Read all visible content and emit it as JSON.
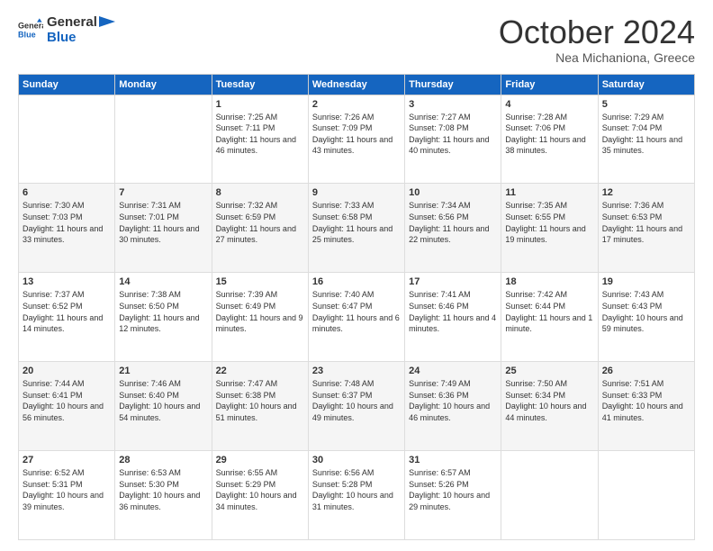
{
  "header": {
    "logo_general": "General",
    "logo_blue": "Blue",
    "month_title": "October 2024",
    "subtitle": "Nea Michaniona, Greece"
  },
  "weekdays": [
    "Sunday",
    "Monday",
    "Tuesday",
    "Wednesday",
    "Thursday",
    "Friday",
    "Saturday"
  ],
  "weeks": [
    [
      {
        "day": "",
        "info": ""
      },
      {
        "day": "",
        "info": ""
      },
      {
        "day": "1",
        "info": "Sunrise: 7:25 AM\nSunset: 7:11 PM\nDaylight: 11 hours and 46 minutes."
      },
      {
        "day": "2",
        "info": "Sunrise: 7:26 AM\nSunset: 7:09 PM\nDaylight: 11 hours and 43 minutes."
      },
      {
        "day": "3",
        "info": "Sunrise: 7:27 AM\nSunset: 7:08 PM\nDaylight: 11 hours and 40 minutes."
      },
      {
        "day": "4",
        "info": "Sunrise: 7:28 AM\nSunset: 7:06 PM\nDaylight: 11 hours and 38 minutes."
      },
      {
        "day": "5",
        "info": "Sunrise: 7:29 AM\nSunset: 7:04 PM\nDaylight: 11 hours and 35 minutes."
      }
    ],
    [
      {
        "day": "6",
        "info": "Sunrise: 7:30 AM\nSunset: 7:03 PM\nDaylight: 11 hours and 33 minutes."
      },
      {
        "day": "7",
        "info": "Sunrise: 7:31 AM\nSunset: 7:01 PM\nDaylight: 11 hours and 30 minutes."
      },
      {
        "day": "8",
        "info": "Sunrise: 7:32 AM\nSunset: 6:59 PM\nDaylight: 11 hours and 27 minutes."
      },
      {
        "day": "9",
        "info": "Sunrise: 7:33 AM\nSunset: 6:58 PM\nDaylight: 11 hours and 25 minutes."
      },
      {
        "day": "10",
        "info": "Sunrise: 7:34 AM\nSunset: 6:56 PM\nDaylight: 11 hours and 22 minutes."
      },
      {
        "day": "11",
        "info": "Sunrise: 7:35 AM\nSunset: 6:55 PM\nDaylight: 11 hours and 19 minutes."
      },
      {
        "day": "12",
        "info": "Sunrise: 7:36 AM\nSunset: 6:53 PM\nDaylight: 11 hours and 17 minutes."
      }
    ],
    [
      {
        "day": "13",
        "info": "Sunrise: 7:37 AM\nSunset: 6:52 PM\nDaylight: 11 hours and 14 minutes."
      },
      {
        "day": "14",
        "info": "Sunrise: 7:38 AM\nSunset: 6:50 PM\nDaylight: 11 hours and 12 minutes."
      },
      {
        "day": "15",
        "info": "Sunrise: 7:39 AM\nSunset: 6:49 PM\nDaylight: 11 hours and 9 minutes."
      },
      {
        "day": "16",
        "info": "Sunrise: 7:40 AM\nSunset: 6:47 PM\nDaylight: 11 hours and 6 minutes."
      },
      {
        "day": "17",
        "info": "Sunrise: 7:41 AM\nSunset: 6:46 PM\nDaylight: 11 hours and 4 minutes."
      },
      {
        "day": "18",
        "info": "Sunrise: 7:42 AM\nSunset: 6:44 PM\nDaylight: 11 hours and 1 minute."
      },
      {
        "day": "19",
        "info": "Sunrise: 7:43 AM\nSunset: 6:43 PM\nDaylight: 10 hours and 59 minutes."
      }
    ],
    [
      {
        "day": "20",
        "info": "Sunrise: 7:44 AM\nSunset: 6:41 PM\nDaylight: 10 hours and 56 minutes."
      },
      {
        "day": "21",
        "info": "Sunrise: 7:46 AM\nSunset: 6:40 PM\nDaylight: 10 hours and 54 minutes."
      },
      {
        "day": "22",
        "info": "Sunrise: 7:47 AM\nSunset: 6:38 PM\nDaylight: 10 hours and 51 minutes."
      },
      {
        "day": "23",
        "info": "Sunrise: 7:48 AM\nSunset: 6:37 PM\nDaylight: 10 hours and 49 minutes."
      },
      {
        "day": "24",
        "info": "Sunrise: 7:49 AM\nSunset: 6:36 PM\nDaylight: 10 hours and 46 minutes."
      },
      {
        "day": "25",
        "info": "Sunrise: 7:50 AM\nSunset: 6:34 PM\nDaylight: 10 hours and 44 minutes."
      },
      {
        "day": "26",
        "info": "Sunrise: 7:51 AM\nSunset: 6:33 PM\nDaylight: 10 hours and 41 minutes."
      }
    ],
    [
      {
        "day": "27",
        "info": "Sunrise: 6:52 AM\nSunset: 5:31 PM\nDaylight: 10 hours and 39 minutes."
      },
      {
        "day": "28",
        "info": "Sunrise: 6:53 AM\nSunset: 5:30 PM\nDaylight: 10 hours and 36 minutes."
      },
      {
        "day": "29",
        "info": "Sunrise: 6:55 AM\nSunset: 5:29 PM\nDaylight: 10 hours and 34 minutes."
      },
      {
        "day": "30",
        "info": "Sunrise: 6:56 AM\nSunset: 5:28 PM\nDaylight: 10 hours and 31 minutes."
      },
      {
        "day": "31",
        "info": "Sunrise: 6:57 AM\nSunset: 5:26 PM\nDaylight: 10 hours and 29 minutes."
      },
      {
        "day": "",
        "info": ""
      },
      {
        "day": "",
        "info": ""
      }
    ]
  ]
}
